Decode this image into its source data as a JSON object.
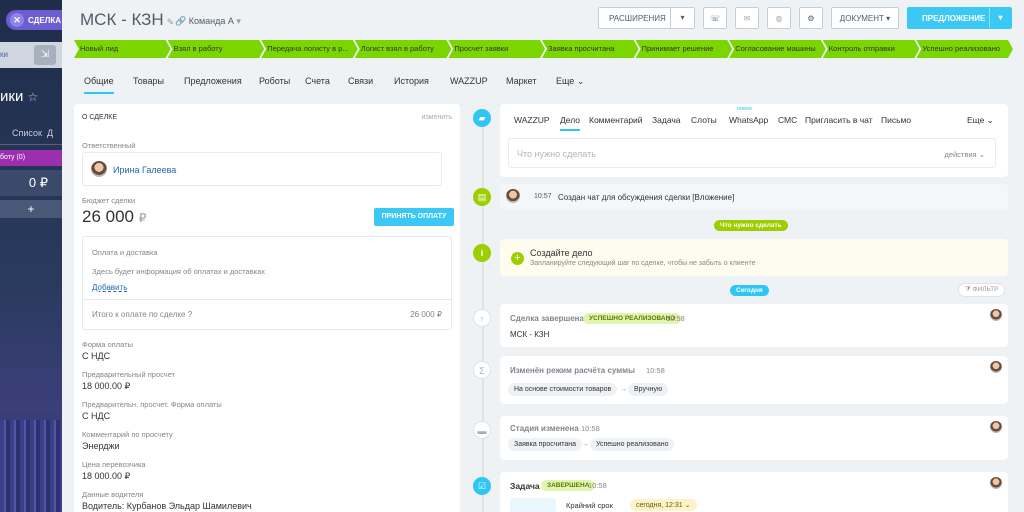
{
  "left": {
    "tag": "СДЕЛКА",
    "band_text": "ки",
    "title_partial": "ики",
    "list_label": "Список",
    "list_label2": "Д",
    "purple_partial": "боту (0)",
    "zero": "0 ₽",
    "plus": "+"
  },
  "header": {
    "title": "МСК - КЗН",
    "team": "Команда А",
    "btn_extensions": "РАСШИРЕНИЯ",
    "btn_document": "ДОКУМЕНТ",
    "btn_offer": "ПРЕДЛОЖЕНИЕ"
  },
  "stages": [
    "Новый лид",
    "Взял в работу",
    "Передача логисту в р...",
    "Логист взял в работу",
    "Просчет заявки",
    "Заявка просчитана",
    "Принимает решение",
    "Согласование машины",
    "Контроль отправки",
    "Успешно реализовано"
  ],
  "tabs": [
    "Общие",
    "Товары",
    "Предложения",
    "Роботы",
    "Счета",
    "Связи",
    "История",
    "WAZZUP",
    "Маркет",
    "Еще"
  ],
  "deal": {
    "section": "О СДЕЛКЕ",
    "edit": "изменить",
    "responsible_label": "Ответственный",
    "responsible": "Ирина Галеева",
    "budget_label": "Бюджет сделки",
    "budget": "26 000",
    "currency": "₽",
    "pay_button": "ПРИНЯТЬ ОПЛАТУ",
    "pay_title": "Оплата и доставка",
    "pay_info": "Здесь будет информация об оплатах и доставках",
    "pay_add": "Добавить",
    "to_pay_label": "Итого к оплате по сделке",
    "to_pay": "26 000 ₽",
    "fields": [
      {
        "label": "Форма оплаты",
        "value": "С НДС"
      },
      {
        "label": "Предварительный просчет",
        "value": "18 000.00 ₽"
      },
      {
        "label": "Предварительн. просчет. Форма оплаты",
        "value": "С НДС"
      },
      {
        "label": "Комментарий по просчету",
        "value": "Энерджи"
      },
      {
        "label": "Цена перевозчика",
        "value": "18 000.00 ₽"
      },
      {
        "label": "Данные водителя",
        "value": "Водитель: Курбанов Эльдар Шамилевич"
      }
    ]
  },
  "composer": {
    "tabs": [
      "WAZZUP",
      "Дело",
      "Комментарий",
      "Задача",
      "Слоты",
      "WhatsApp",
      "СМС",
      "Пригласить в чат",
      "Письмо",
      "Еще"
    ],
    "new_badge": "новое",
    "placeholder": "Что нужно сделать",
    "actions": "действия"
  },
  "feed": {
    "chat_time": "10:57",
    "chat_text": "Создан чат для обсуждения сделки [Вложение]",
    "todo_badge": "Что нужно сделать",
    "create_title": "Создайте дело",
    "create_hint": "Запланируйте следующий шаг по сделке, чтобы не забыть о клиенте",
    "today_badge": "Сегодня",
    "filter": "ФИЛЬТР",
    "items": [
      {
        "title": "Сделка завершена",
        "badge": "УСПЕШНО РЕАЛИЗОВАНО",
        "time": "10:58",
        "text": "МСК - КЗН"
      },
      {
        "title": "Изменён режим расчёта суммы",
        "time": "10:58",
        "from": "На основе стоимости товаров",
        "to": "Вручную"
      },
      {
        "title": "Стадия изменена",
        "time": "10:58",
        "from": "Заявка просчитана",
        "to": "Успешно реализовано"
      },
      {
        "title": "Задача",
        "badge": "ЗАВЕРШЕНА",
        "time": "10:58",
        "deadline_label": "Крайний срок",
        "deadline": "сегодня, 12:31"
      }
    ],
    "arrow": "→"
  },
  "colors": {
    "accent": "#2fc6f6",
    "stage": "#7bd500",
    "sidebar_tag": "#6d5dd3"
  }
}
